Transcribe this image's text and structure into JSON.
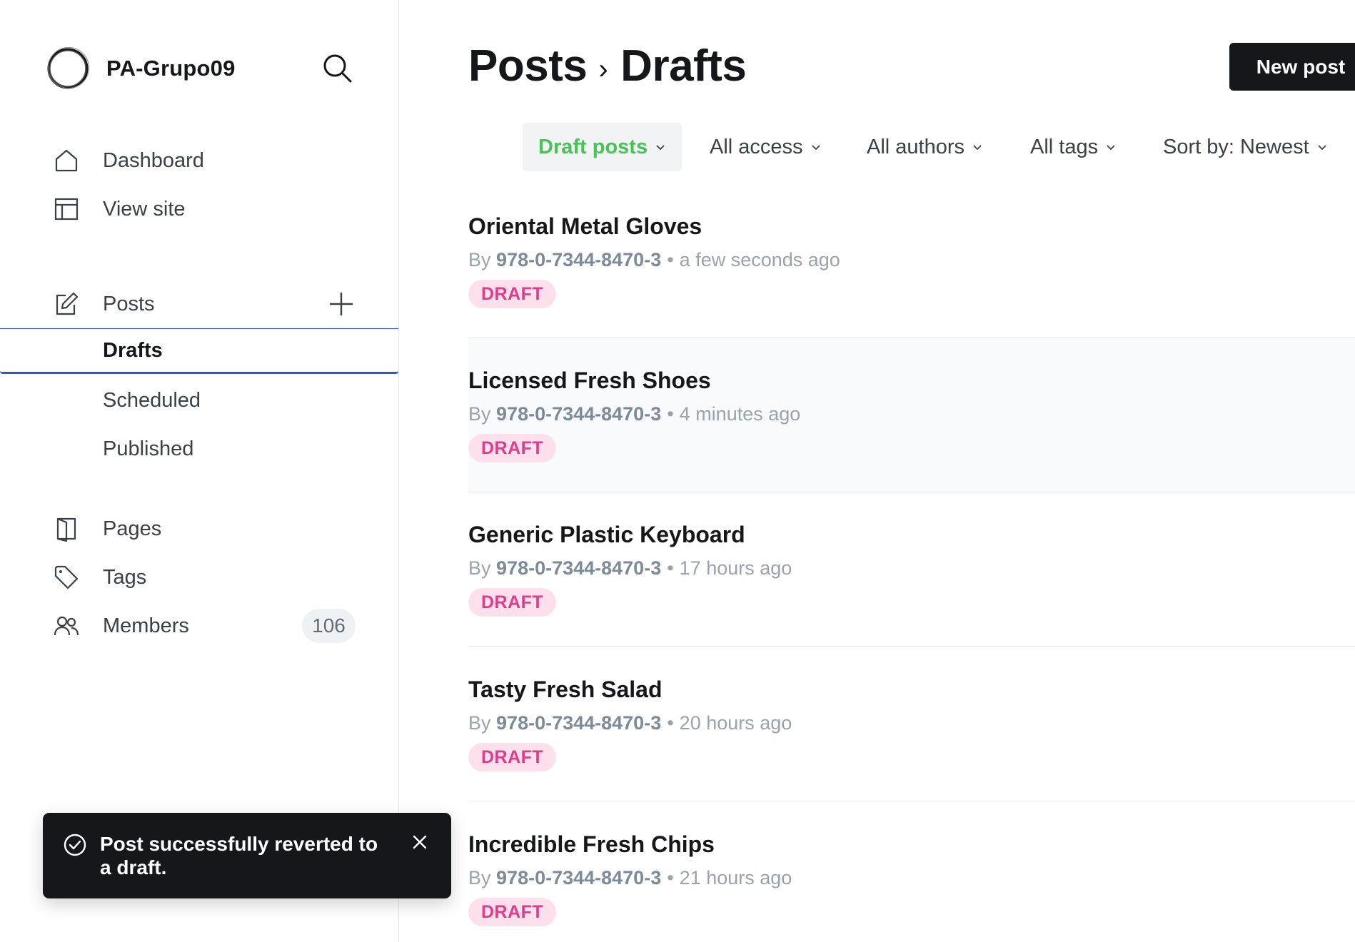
{
  "site": {
    "name": "PA-Grupo09"
  },
  "nav": {
    "dashboard": "Dashboard",
    "view_site": "View site",
    "posts": "Posts",
    "drafts": "Drafts",
    "scheduled": "Scheduled",
    "published": "Published",
    "pages": "Pages",
    "tags": "Tags",
    "members": "Members",
    "members_count": "106"
  },
  "breadcrumb": {
    "parent": "Posts",
    "separator": "›",
    "current": "Drafts"
  },
  "actions": {
    "new_post": "New post"
  },
  "filters": {
    "type": "Draft posts",
    "access": "All access",
    "authors": "All authors",
    "tags": "All tags",
    "sort": "Sort by: Newest"
  },
  "posts": [
    {
      "title": "Oriental Metal Gloves",
      "by": "By",
      "author": "978-0-7344-8470-3",
      "time": "a few seconds ago",
      "status": "DRAFT"
    },
    {
      "title": "Licensed Fresh Shoes",
      "by": "By",
      "author": "978-0-7344-8470-3",
      "time": "4 minutes ago",
      "status": "DRAFT"
    },
    {
      "title": "Generic Plastic Keyboard",
      "by": "By",
      "author": "978-0-7344-8470-3",
      "time": "17 hours ago",
      "status": "DRAFT"
    },
    {
      "title": "Tasty Fresh Salad",
      "by": "By",
      "author": "978-0-7344-8470-3",
      "time": "20 hours ago",
      "status": "DRAFT"
    },
    {
      "title": "Incredible Fresh Chips",
      "by": "By",
      "author": "978-0-7344-8470-3",
      "time": "21 hours ago",
      "status": "DRAFT"
    }
  ],
  "toast": {
    "message": "Post successfully reverted to a draft."
  },
  "colors": {
    "accent_green": "#4bc257",
    "draft_pink": "#e23b8a",
    "draft_bg": "#fde0ec",
    "active_border": "#3556c1",
    "dark": "#15171a"
  },
  "icons": {
    "brand": "brand-logo-icon",
    "search": "search-icon",
    "dashboard": "home-icon",
    "view_site": "layout-icon",
    "posts": "edit-icon",
    "add": "plus-icon",
    "pages": "page-icon",
    "tags": "tag-icon",
    "members": "members-icon",
    "toast": "check-circle-icon",
    "close": "close-icon",
    "caret": "chevron-down-icon"
  }
}
